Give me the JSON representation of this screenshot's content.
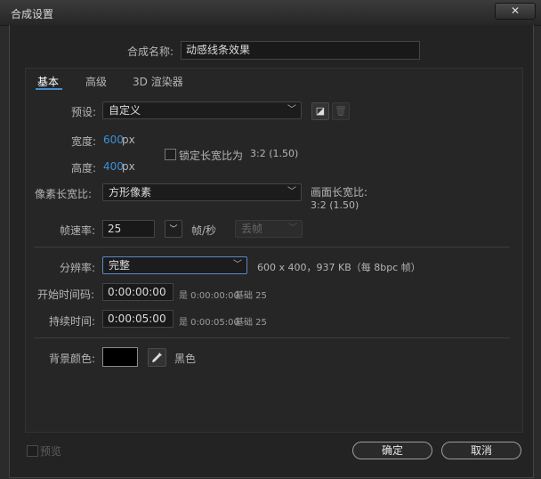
{
  "window": {
    "title": "合成设置",
    "close": "✕"
  },
  "comp_name": {
    "label": "合成名称:",
    "value": "动感线条效果"
  },
  "tabs": [
    "基本",
    "高级",
    "3D 渲染器"
  ],
  "preset": {
    "label": "预设:",
    "value": "自定义"
  },
  "width": {
    "label": "宽度:",
    "value": "600",
    "unit": "px"
  },
  "height": {
    "label": "高度:",
    "value": "400",
    "unit": "px"
  },
  "lock_ratio": {
    "label": "锁定长宽比为",
    "value": "3:2 (1.50)"
  },
  "pixel_aspect": {
    "label": "像素长宽比:",
    "value": "方形像素"
  },
  "frame_aspect": {
    "label": "画面长宽比:",
    "value": "3:2 (1.50)"
  },
  "frame_rate": {
    "label": "帧速率:",
    "value": "25",
    "unit": "帧/秒",
    "drop_frame": "丢帧"
  },
  "resolution": {
    "label": "分辨率:",
    "value": "完整",
    "info": "600 x 400，937 KB（每 8bpc 帧）"
  },
  "start_timecode": {
    "label": "开始时间码:",
    "value": "0:00:00:00",
    "note": "是 0:00:00:00",
    "base": "基础 25"
  },
  "duration": {
    "label": "持续时间:",
    "value": "0:00:05:00",
    "note": "是 0:00:05:00",
    "base": "基础 25"
  },
  "bg_color": {
    "label": "背景颜色:",
    "name": "黑色",
    "color": "#000000"
  },
  "footer": {
    "preview": "预览",
    "ok": "确定",
    "cancel": "取消"
  }
}
